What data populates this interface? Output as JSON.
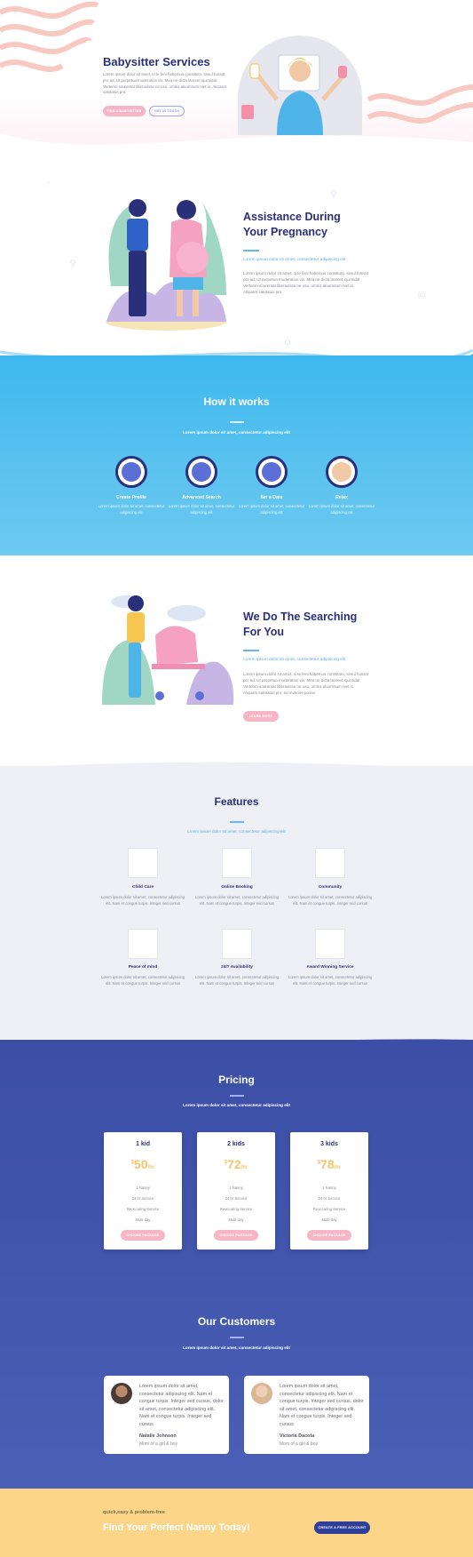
{
  "hero": {
    "title": "Babysitter Services",
    "text": "Lorem ipsum dolor sit amet, si te feni habemus constituto, simul fuissat pro ad. Ut perpetua moderatius vis, Mea ne dicta laoreet iqucsidat. Vertenm sourentat liberavisse ne usu, omnis aluomnum niet in. Aliquam salutatus pro.",
    "btn_primary": "Find a Babysitter",
    "btn_secondary": "Get in Touch"
  },
  "assistance": {
    "title_line1": "Assistance During",
    "title_line2": "Your Pregnancy",
    "subtitle": "Lorem ipsum dolor sit amet, consectetur adipiscing elit",
    "text": "Lorem ipsum dolor sit amet, si te feni habemus constituto, simul fuissat pro ad. Ut perpetua moderatius vis. Mea ne dicta laoreet iqucsidat. Vertenm sourentat liberavisse ne usu, omnis aluomnum niet in. Aliquam salutatus pro."
  },
  "how": {
    "title": "How it works",
    "subtitle": "Lorem ipsum dolor sit amet, consectetur adipiscing elit",
    "steps": [
      {
        "title": "Create Profile",
        "desc": "Lorem ipsum dolor sit amet, consectetur adipiscing elit"
      },
      {
        "title": "Advanced Search",
        "desc": "Lorem ipsum dolor sit amet, consectetur adipiscing elit"
      },
      {
        "title": "Set a Date",
        "desc": "Lorem ipsum dolor sit amet, consectetur adipiscing elit"
      },
      {
        "title": "Relax",
        "desc": "Lorem ipsum dolor sit amet, consectetur adipiscing elit"
      }
    ]
  },
  "searching": {
    "title_line1": "We Do The Searching",
    "title_line2": "For You",
    "subtitle": "Lorem ipsum dolor sit amet, consectetur adipiscing elit",
    "text": "Lorem ipsum dolor sit amet, si te feni habemus constituto, simul fuissat pro ad. Ut perpetua moderatius vis. Mea ne dicta laoreet iqucsidat. Vertenm sourentat liberavisse ne usu, omnis aluomnum niet in. Aliquam salutatus pro. ne invenire posse.",
    "button": "Learn More"
  },
  "features": {
    "title": "Features",
    "subtitle": "Lorem ipsum dolor sit amet, consectetur adipiscing elit",
    "items": [
      {
        "title": "Child Care",
        "desc": "Lorem ipsum dolor sit amet, consectetur adipiscing elit. Nam et congue turpis. Integer sed cursus",
        "icon": "child-care-icon"
      },
      {
        "title": "Online Booking",
        "desc": "Lorem ipsum dolor sit amet, consectetur adipiscing elit. Nam et congue turpis. Integer sed cursus",
        "icon": "online-booking-icon"
      },
      {
        "title": "Community",
        "desc": "Lorem ipsum dolor sit amet, consectetur adipiscing elit. Nam et congue turpis. Integer sed cursus",
        "icon": "community-icon"
      },
      {
        "title": "Peace of mind",
        "desc": "Lorem ipsum dolor sit amet, consectetur adipiscing elit. Nam et congue turpis. Integer sed cursus",
        "icon": "peace-of-mind-icon"
      },
      {
        "title": "24/7 Availability",
        "desc": "Lorem ipsum dolor sit amet, consectetur adipiscing elit. Nam et congue turpis. Integer sed cursus",
        "icon": "clock-icon"
      },
      {
        "title": "Award Winning Service",
        "desc": "Lorem ipsum dolor sit amet, consectetur adipiscing elit. Nam et congue turpis. Integer sed cursus",
        "icon": "award-icon"
      }
    ]
  },
  "pricing": {
    "title": "Pricing",
    "subtitle": "Lorem ipsum dolor sit amet, consectetur adipiscing elit",
    "plans": [
      {
        "name": "1 kid",
        "currency": "$",
        "price": "50",
        "period": "/hr",
        "f1": "1 Nanny",
        "f2": "24 hr Service",
        "f3": "Reoccuring Service",
        "f4": "Multi-day",
        "button": "Choose Package"
      },
      {
        "name": "2 kids",
        "currency": "$",
        "price": "72",
        "period": "/hr",
        "f1": "1 Nanny",
        "f2": "24 hr Service",
        "f3": "Reoccuring Service",
        "f4": "Multi-day",
        "button": "Choose Package"
      },
      {
        "name": "3 kids",
        "currency": "$",
        "price": "78",
        "period": "/hr",
        "f1": "1 Nanny",
        "f2": "24 hr Service",
        "f3": "Reoccuring Service",
        "f4": "Multi-day",
        "button": "Choose Package"
      }
    ]
  },
  "customers": {
    "title": "Our Customers",
    "subtitle": "Lorem ipsum dolor sit amet, consectetur adipiscing elit",
    "items": [
      {
        "text": "Lorem ipsum dolor sit amet, consectetur adipiscing elit. Nam et congue turpis. Integer sed cursus, dolor sit amet, consectetur adipiscing elit. Nam et congue turpis. Integer sed cursus",
        "name": "Natalie Johnson",
        "role": "Mom of a girl & boy"
      },
      {
        "text": "Lorem ipsum dolor sit amet, consectetur adipiscing elit. Nam et congue turpis. Integer sed cursus, dolor sit amet, consectetur adipiscing elit. Nam et congue turpis. Integer sed cursus",
        "name": "Victoria Dacota",
        "role": "Mom of a girl & boy"
      }
    ]
  },
  "footer": {
    "tagline": "quick,easy & problem-free",
    "headline": "Find Your Perfect Nanny Today!",
    "button": "Create a Free Account"
  },
  "colors": {
    "navy": "#2a2f7a",
    "sky": "#3db8ee",
    "pink": "#f7b6c6",
    "indigo": "#3c4ea6",
    "yellow": "#fcd589"
  }
}
